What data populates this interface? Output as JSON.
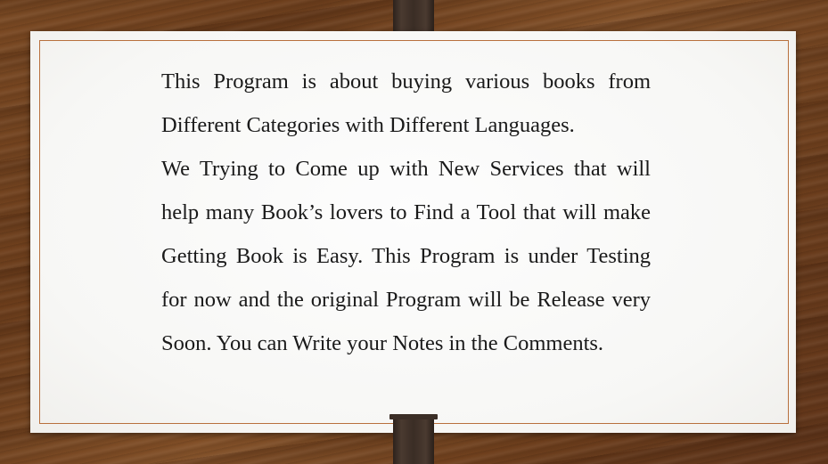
{
  "slide": {
    "paragraphs": [
      "This Program is about buying various books from Different Categories with Different Languages.",
      "We Trying to Come up with New Services that will help many Book’s lovers to Find a Tool that will make Getting Book is Easy. This Program is under Testing  for now and the original Program will be Release very Soon. You can Write your Notes in the Comments."
    ]
  },
  "colors": {
    "wood": "#6a3d1c",
    "paper": "#f7f7f5",
    "frame_line": "#b8703d",
    "clip": "#3a2d25",
    "text": "#1a1a1a"
  }
}
